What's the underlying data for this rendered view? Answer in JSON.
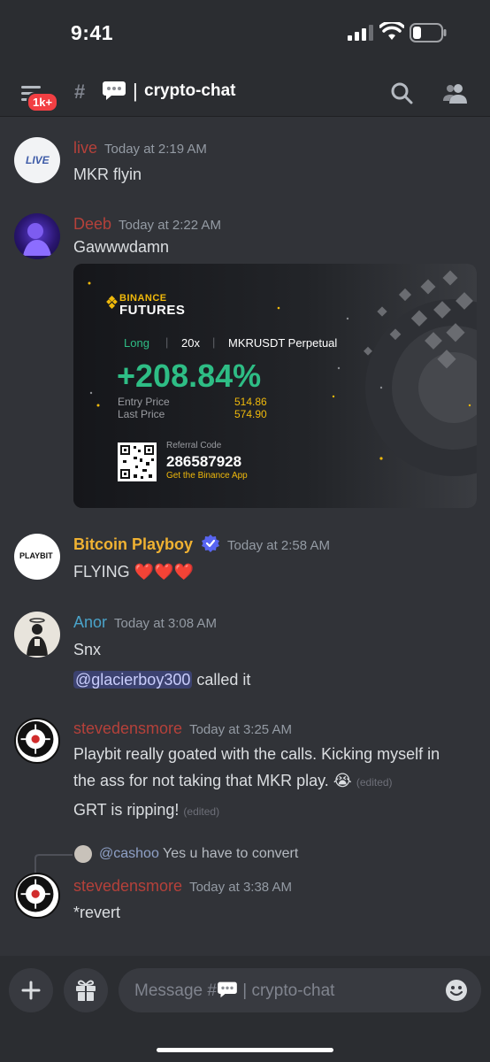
{
  "status": {
    "time": "9:41"
  },
  "header": {
    "badge": "1k+",
    "separator": "|",
    "channel": "crypto-chat"
  },
  "messages": [
    {
      "author": "live",
      "time": "Today at 2:19 AM",
      "avatar_text": "LIVE",
      "lines": [
        "MKR flyin"
      ]
    },
    {
      "author": "Deeb",
      "time": "Today at 2:22 AM",
      "lines": [
        "Gawwwdamn"
      ]
    },
    {
      "author": "Bitcoin Playboy",
      "time": "Today at 2:58 AM",
      "avatar_text": "PLAYBIT",
      "lines": [
        "FLYING ❤️❤️❤️"
      ]
    },
    {
      "author": "Anor",
      "time": "Today at 3:08 AM",
      "lines": [
        "Snx"
      ],
      "mention": "@glacierboy300",
      "mention_suffix": " called it"
    },
    {
      "author": "stevedensmore",
      "time": "Today at 3:25 AM",
      "lines": [
        "Playbit really goated with the calls. Kicking myself in",
        "the ass for not taking that MKR play. 😭",
        "GRT is ripping!"
      ],
      "edited": "(edited)"
    },
    {
      "author": "stevedensmore",
      "time": "Today at 3:38 AM",
      "reply_to": "@cashoo",
      "reply_text": "Yes u have to convert",
      "lines": [
        "*revert"
      ]
    }
  ],
  "embed": {
    "brand": "BINANCE",
    "product": "FUTURES",
    "side": "Long",
    "leverage": "20x",
    "symbol": "MKRUSDT Perpetual",
    "roi": "+208.84%",
    "entry_label": "Entry Price",
    "entry_value": "514.86",
    "last_label": "Last Price",
    "last_value": "574.90",
    "ref_label": "Referral Code",
    "ref_code": "286587928",
    "app_cta": "Get the Binance App"
  },
  "composer": {
    "placeholder_prefix": "Message #",
    "placeholder_suffix": "| crypto-chat"
  },
  "colors": {
    "live": "#b5413a",
    "deeb": "#b5413a",
    "playboy": "#f0b232",
    "anor": "#4aa3c9",
    "steve": "#b5413a",
    "long": "#2ebd85",
    "binance": "#f0b90b"
  },
  "icons": [
    "hamburger-icon",
    "hash-lock-icon",
    "speech-bubble-icon",
    "search-icon",
    "members-icon",
    "verified-icon",
    "plus-icon",
    "gift-icon",
    "emoji-icon"
  ]
}
